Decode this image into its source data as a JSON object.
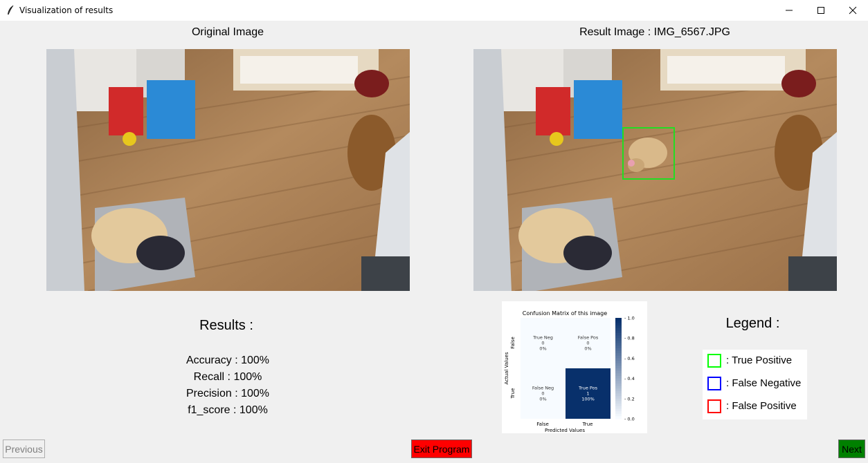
{
  "window": {
    "title": "Visualization of results"
  },
  "original": {
    "label": "Original Image"
  },
  "result": {
    "label": "Result Image : IMG_6567.JPG"
  },
  "results": {
    "title": "Results :",
    "metrics": [
      "Accuracy : 100%",
      "Recall : 100%",
      "Precision : 100%",
      "f1_score : 100%"
    ]
  },
  "confusion_matrix": {
    "title": "Confusion Matrix of this image",
    "xlabel": "Predicted Values",
    "ylabel": "Actual Values",
    "x_ticks": [
      "False",
      "True"
    ],
    "y_ticks": [
      "False",
      "True"
    ],
    "cells": [
      [
        {
          "label": "True Neg",
          "count": "0",
          "pct": "0%",
          "value": 0
        },
        {
          "label": "False Pos",
          "count": "0",
          "pct": "0%",
          "value": 0
        }
      ],
      [
        {
          "label": "False Neg",
          "count": "0",
          "pct": "0%",
          "value": 0
        },
        {
          "label": "True Pos",
          "count": "1",
          "pct": "100%",
          "value": 1
        }
      ]
    ],
    "colorbar_ticks": [
      "1.0",
      "0.8",
      "0.6",
      "0.4",
      "0.2",
      "0.0"
    ],
    "colors": {
      "low": "#f7fbff",
      "high": "#08306b"
    }
  },
  "legend": {
    "title": "Legend :",
    "items": [
      {
        "label": ":  True Positive",
        "color": "#00ff00"
      },
      {
        "label": ":  False Negative",
        "color": "#0000ff"
      },
      {
        "label": ":  False Positive",
        "color": "#ff0000"
      }
    ]
  },
  "buttons": {
    "previous": "Previous",
    "exit": "Exit Program",
    "next": "Next"
  },
  "detection": {
    "box_color": "#22dd22"
  }
}
